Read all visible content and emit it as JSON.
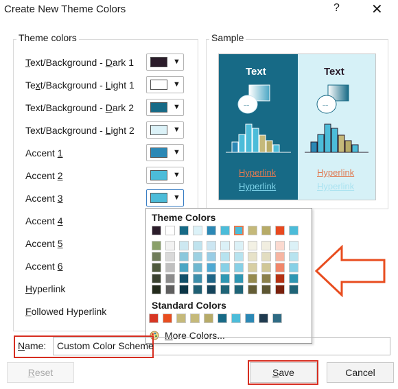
{
  "dialog": {
    "title": "Create New Theme Colors",
    "help": "?",
    "close": "✕"
  },
  "theme_colors": {
    "label": "Theme colors",
    "rows": [
      {
        "label": "Text/Background - Dark 1",
        "color": "#2b1c2a"
      },
      {
        "label": "Text/Background - Light 1",
        "color": "#ffffff"
      },
      {
        "label": "Text/Background - Dark 2",
        "color": "#176a86"
      },
      {
        "label": "Text/Background - Light 2",
        "color": "#dcf2f8"
      },
      {
        "label": "Accent 1",
        "color": "#2b88b5"
      },
      {
        "label": "Accent 2",
        "color": "#4cbcd9"
      },
      {
        "label": "Accent 3",
        "color": "#4cbcd9"
      },
      {
        "label": "Accent 4",
        "color": ""
      },
      {
        "label": "Accent 5",
        "color": ""
      },
      {
        "label": "Accent 6",
        "color": ""
      },
      {
        "label": "Hyperlink",
        "color": ""
      },
      {
        "label": "Followed Hyperlink",
        "color": ""
      }
    ]
  },
  "sample": {
    "label": "Sample",
    "text_dark": "Text",
    "text_light": "Text",
    "hyperlink": "Hyperlink",
    "followed_hyperlink": "Hyperlink",
    "colors": {
      "dark_bg": "#176a86",
      "light_bg": "#d6f1f7",
      "hyperlink_dark": "#e07a52",
      "followed_dark": "#7fd4ea",
      "hyperlink_light": "#e07a52",
      "followed_light": "#a9e2f0"
    }
  },
  "palette": {
    "theme_title": "Theme Colors",
    "standard_title": "Standard Colors",
    "more_colors": "More Colors...",
    "theme_columns": [
      [
        "#2b1c2a",
        "#8aa06a",
        "#6f7c5a",
        "#4f5a3d",
        "#3a4230",
        "#232a1c"
      ],
      [
        "#ffffff",
        "#f2f2f2",
        "#d9d9d9",
        "#bfbfbf",
        "#8c8c8c",
        "#5f5f5f"
      ],
      [
        "#176a86",
        "#cde8f1",
        "#8cc8dc",
        "#4aa6c4",
        "#11506a",
        "#0b3546"
      ],
      [
        "#dcf2f8",
        "#bfe3ee",
        "#9dd1e2",
        "#6fb8d0",
        "#3d8fab",
        "#1f5f73"
      ],
      [
        "#2b88b5",
        "#cce6f2",
        "#99cde5",
        "#4fa9d3",
        "#1f6688",
        "#14445b"
      ],
      [
        "#4cbcd9",
        "#dbf1f7",
        "#b7e3ef",
        "#87d0e6",
        "#2f97b3",
        "#1f6477"
      ],
      [
        "#4cbcd9",
        "#dbf1f7",
        "#b7e3ef",
        "#87d0e6",
        "#2f97b3",
        "#1f6477"
      ],
      [
        "#c5b97a",
        "#f3f1e4",
        "#e7e2c9",
        "#d7cea3",
        "#968b4f",
        "#645d35"
      ],
      [
        "#b7ab68",
        "#f1eee0",
        "#e2ddc1",
        "#d0c797",
        "#8b804a",
        "#5d5632"
      ],
      [
        "#e8491f",
        "#fbdad0",
        "#f6b5a2",
        "#f0866a",
        "#b53113",
        "#79200c"
      ],
      [
        "#4cbcd9",
        "#dbf1f7",
        "#b7e3ef",
        "#87d0e6",
        "#2f97b3",
        "#1f6477"
      ]
    ],
    "standard": [
      "#d73623",
      "#e84d1f",
      "#c5b97a",
      "#c5b97a",
      "#b7ab68",
      "#176a86",
      "#4cbcd9",
      "#2b88b5",
      "#1f3a4f",
      "#2f6b84"
    ]
  },
  "name": {
    "label": "Name:",
    "value": "Custom Color Scheme"
  },
  "buttons": {
    "reset": "Reset",
    "save": "Save",
    "cancel": "Cancel"
  },
  "arrow": {
    "color": "#e84d1f"
  },
  "accent_red": "#d62d20"
}
